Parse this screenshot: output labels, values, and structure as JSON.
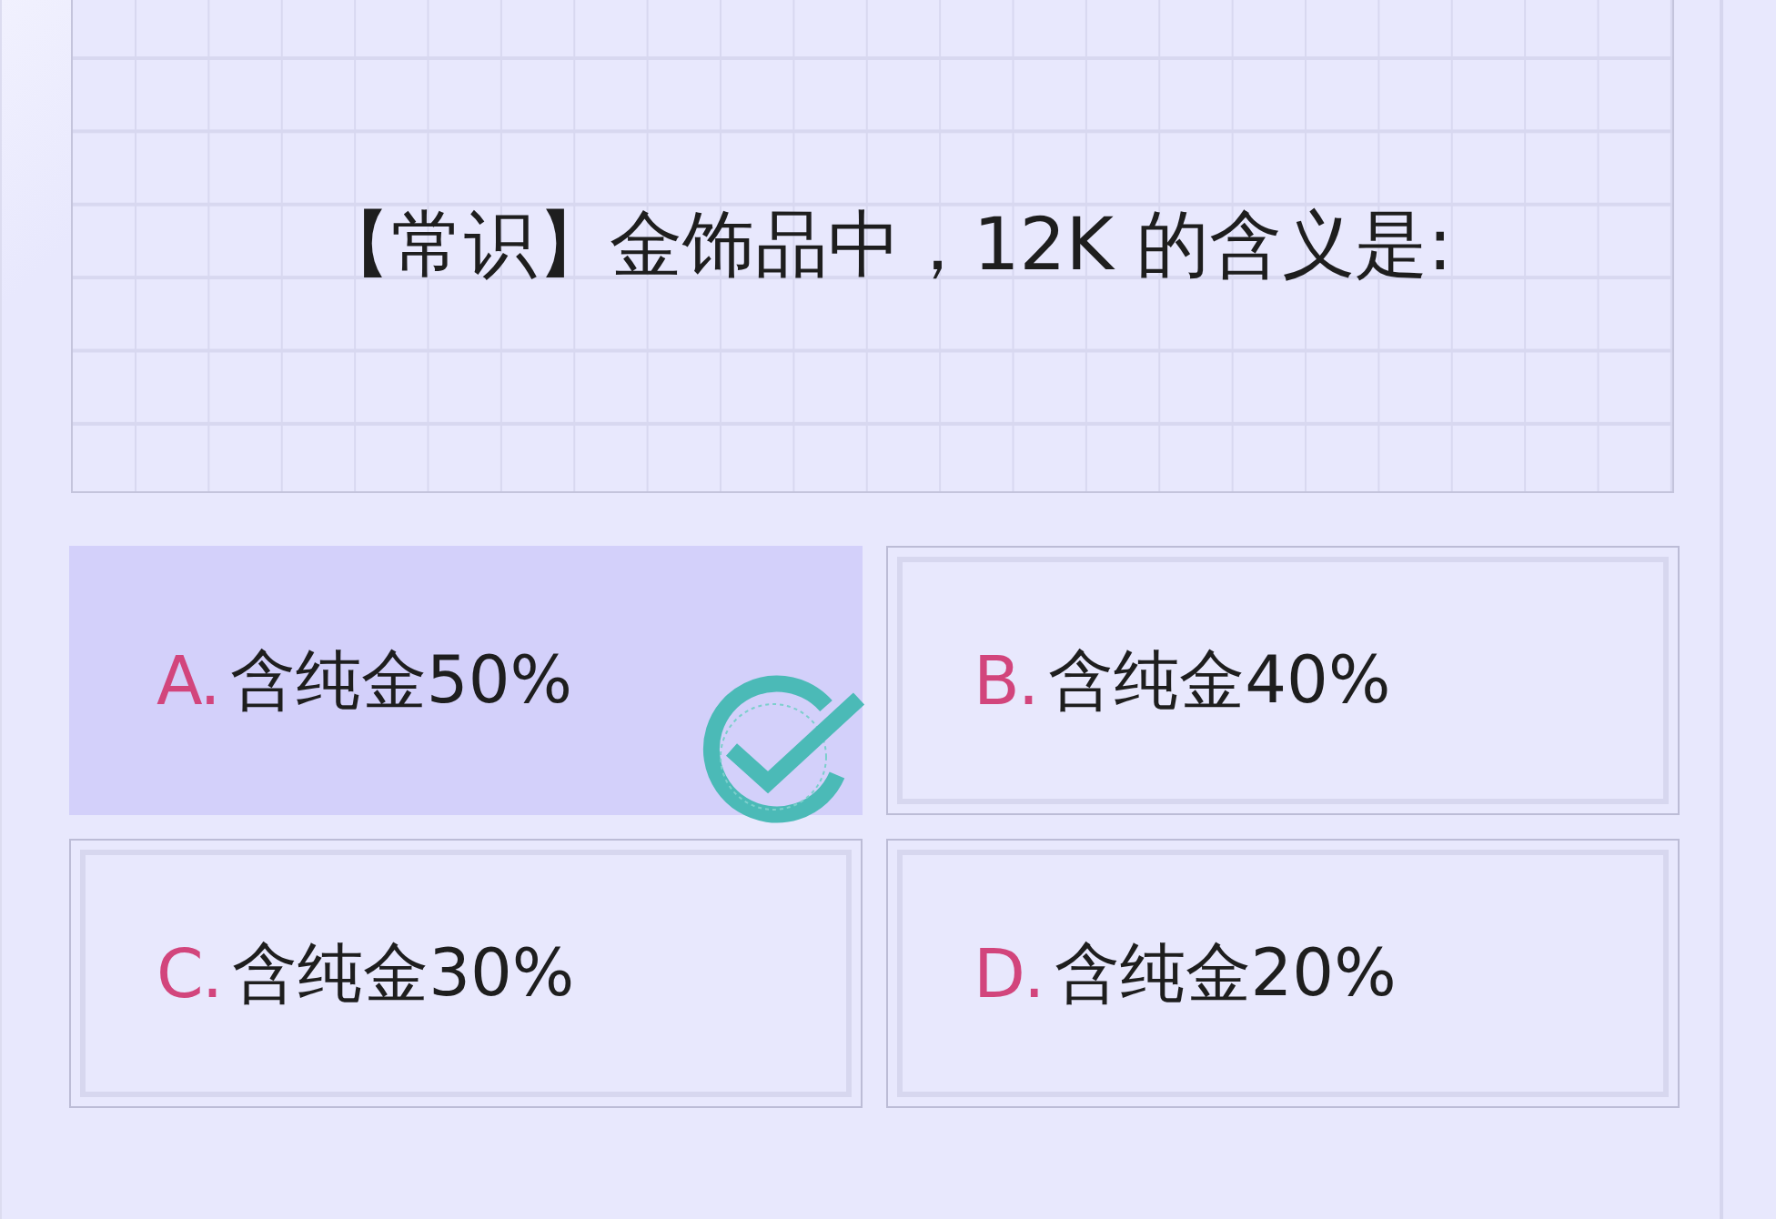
{
  "question": {
    "text": "【常识】金饰品中，12K 的含义是:"
  },
  "options": [
    {
      "letter": "A.",
      "text": "含纯金50%",
      "selected": true,
      "checked": true
    },
    {
      "letter": "B.",
      "text": "含纯金40%",
      "selected": false,
      "checked": false
    },
    {
      "letter": "C.",
      "text": "含纯金30%",
      "selected": false,
      "checked": false
    },
    {
      "letter": "D.",
      "text": "含纯金20%",
      "selected": false,
      "checked": false
    }
  ]
}
